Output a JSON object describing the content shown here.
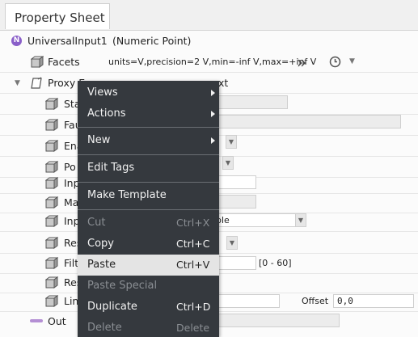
{
  "tab": {
    "label": "Property Sheet"
  },
  "header": {
    "component": "UniversalInput1",
    "type": "(Numeric Point)"
  },
  "facets": {
    "label": "Facets",
    "value": "units=V,precision=2 V,min=-inf V,max=+inf V"
  },
  "proxy": {
    "label_prefix": "Proxy E",
    "label_suffix": "xt"
  },
  "rows": [
    {
      "label": "Sta"
    },
    {
      "label": "Fau"
    },
    {
      "label": "Ena"
    },
    {
      "label": "Po"
    },
    {
      "label": "Inp"
    },
    {
      "label": "Ma"
    },
    {
      "label": "Inp"
    },
    {
      "label": "Res"
    },
    {
      "label": "Filt"
    },
    {
      "label": "Res"
    },
    {
      "label": "Lin"
    }
  ],
  "fields": {
    "input_type_tail": "ble",
    "filter_range": "[0 - 60]",
    "offset_label": "Offset",
    "offset_value": "0,0"
  },
  "out": {
    "label": "Out"
  },
  "menu": {
    "items": [
      {
        "label": "Views",
        "shortcut": "",
        "submenu": true,
        "disabled": false
      },
      {
        "label": "Actions",
        "shortcut": "",
        "submenu": true,
        "disabled": false
      },
      {
        "label": "New",
        "shortcut": "",
        "submenu": true,
        "disabled": false
      },
      {
        "label": "Edit Tags",
        "shortcut": "",
        "submenu": false,
        "disabled": false
      },
      {
        "label": "Make Template",
        "shortcut": "",
        "submenu": false,
        "disabled": false
      },
      {
        "label": "Cut",
        "shortcut": "Ctrl+X",
        "submenu": false,
        "disabled": true
      },
      {
        "label": "Copy",
        "shortcut": "Ctrl+C",
        "submenu": false,
        "disabled": false
      },
      {
        "label": "Paste",
        "shortcut": "Ctrl+V",
        "submenu": false,
        "disabled": false
      },
      {
        "label": "Paste Special",
        "shortcut": "",
        "submenu": false,
        "disabled": true
      },
      {
        "label": "Duplicate",
        "shortcut": "Ctrl+D",
        "submenu": false,
        "disabled": false
      },
      {
        "label": "Delete",
        "shortcut": "Delete",
        "submenu": false,
        "disabled": true
      }
    ]
  },
  "colors": {
    "menu_bg": "#35393e",
    "menu_hover": "#e4e4e4",
    "accent_purple": "#8a5fc9"
  }
}
